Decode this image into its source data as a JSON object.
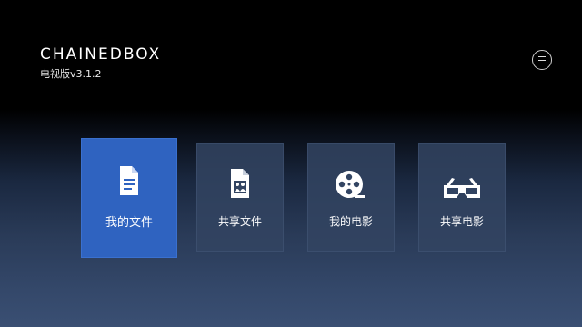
{
  "app": {
    "brand": "CHAINEDBOX",
    "version": "电视版v3.1.2"
  },
  "menu": {
    "icon": "menu-icon"
  },
  "tiles": [
    {
      "label": "我的文件",
      "icon": "document-icon",
      "selected": true
    },
    {
      "label": "共享文件",
      "icon": "shared-document-icon",
      "selected": false
    },
    {
      "label": "我的电影",
      "icon": "film-reel-icon",
      "selected": false
    },
    {
      "label": "共享电影",
      "icon": "3d-glasses-icon",
      "selected": false
    }
  ],
  "colors": {
    "selected_tile": "#2f63c0",
    "tile": "#324462",
    "background_top": "#000000",
    "background_bottom": "#3a4f73"
  }
}
